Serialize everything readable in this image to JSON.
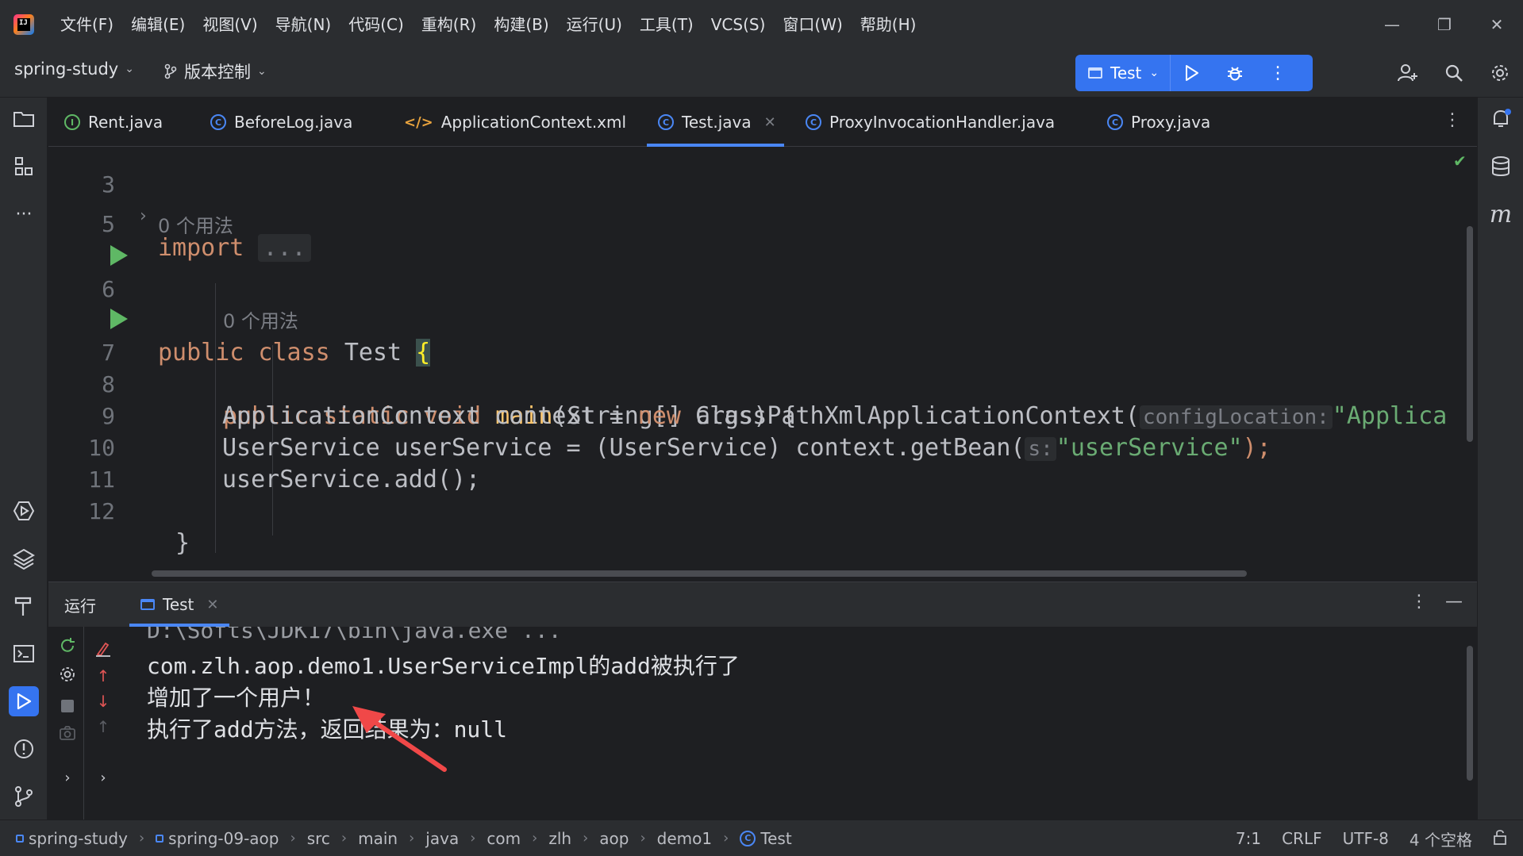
{
  "menu": [
    "文件(F)",
    "编辑(E)",
    "视图(V)",
    "导航(N)",
    "代码(C)",
    "重构(R)",
    "构建(B)",
    "运行(U)",
    "工具(T)",
    "VCS(S)",
    "窗口(W)",
    "帮助(H)"
  ],
  "toolbar": {
    "project": "spring-study",
    "vcs": "版本控制",
    "run_config": "Test"
  },
  "tabs": [
    {
      "label": "Rent.java",
      "icon": "interface-icon"
    },
    {
      "label": "BeforeLog.java",
      "icon": "class-icon"
    },
    {
      "label": "ApplicationContext.xml",
      "icon": "xml-icon"
    },
    {
      "label": "Test.java",
      "icon": "class-icon",
      "active": true
    },
    {
      "label": "ProxyInvocationHandler.java",
      "icon": "class-icon"
    },
    {
      "label": "Proxy.java",
      "icon": "class-icon"
    }
  ],
  "editor": {
    "line_numbers": [
      "3",
      "5",
      "6",
      "7",
      "8",
      "9",
      "10",
      "11",
      "12"
    ],
    "import_kw": "import",
    "import_fold": "...",
    "usage_hint_1": "0 个用法",
    "usage_hint_2": "0 个用法",
    "line6": {
      "kw": "public class",
      "name": "Test",
      "brace": "{"
    },
    "line7": {
      "kw": "public static void",
      "name": "main",
      "rest": "(String[] args) {"
    },
    "line8": {
      "pre": "ApplicationContext context = ",
      "kw": "new",
      "cls": " ClassPathXmlApplicationContext(",
      "hint": "configLocation:",
      "str": "\"Applica"
    },
    "line9": {
      "pre": "UserService userService = (UserService) context.getBean(",
      "hint": "s:",
      "str": "\"userService\"",
      "post": ");"
    },
    "line10": "userService.add();",
    "line12": "}"
  },
  "run_panel": {
    "title": "运行",
    "tab": "Test",
    "console": [
      "D:\\Softs\\JDK17\\bin\\java.exe ...",
      "com.zlh.aop.demo1.UserServiceImpl的add被执行了",
      "增加了一个用户！",
      "执行了add方法，返回结果为：null"
    ]
  },
  "status": {
    "breadcrumbs": [
      "spring-study",
      "spring-09-aop",
      "src",
      "main",
      "java",
      "com",
      "zlh",
      "aop",
      "demo1",
      "Test"
    ],
    "position": "7:1",
    "line_sep": "CRLF",
    "encoding": "UTF-8",
    "indent": "4 个空格"
  },
  "colors": {
    "accent": "#3574f0",
    "keyword": "#cf8e6d",
    "string": "#6aab73",
    "function": "#56a8f5",
    "run_green": "#5fb865",
    "arrow": "#f04848"
  }
}
